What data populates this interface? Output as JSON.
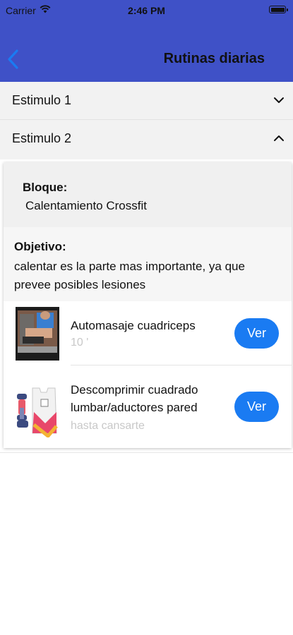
{
  "status_bar": {
    "carrier": "Carrier",
    "time": "2:46 PM"
  },
  "nav": {
    "title": "Rutinas diarias",
    "back_icon": "chevron-left-icon"
  },
  "accordion": [
    {
      "label": "Estimulo 1",
      "state": "collapsed"
    },
    {
      "label": "Estimulo 2",
      "state": "expanded"
    }
  ],
  "block": {
    "title": "Bloque:",
    "value": "Calentamiento Crossfit"
  },
  "objective": {
    "title": "Objetivo:",
    "text": " calentar es la parte mas importante, ya que prevee posibles lesiones"
  },
  "exercises": [
    {
      "title": "Automasaje cuadriceps",
      "subtitle": "10 '",
      "button": "Ver"
    },
    {
      "title": "Descomprimir cuadrado lumbar/aductores pared",
      "subtitle": "hasta cansarte",
      "button": "Ver"
    }
  ],
  "colors": {
    "header": "#3f51c7",
    "accent": "#1a7bf2",
    "back_chevron": "#1a7bf2"
  }
}
